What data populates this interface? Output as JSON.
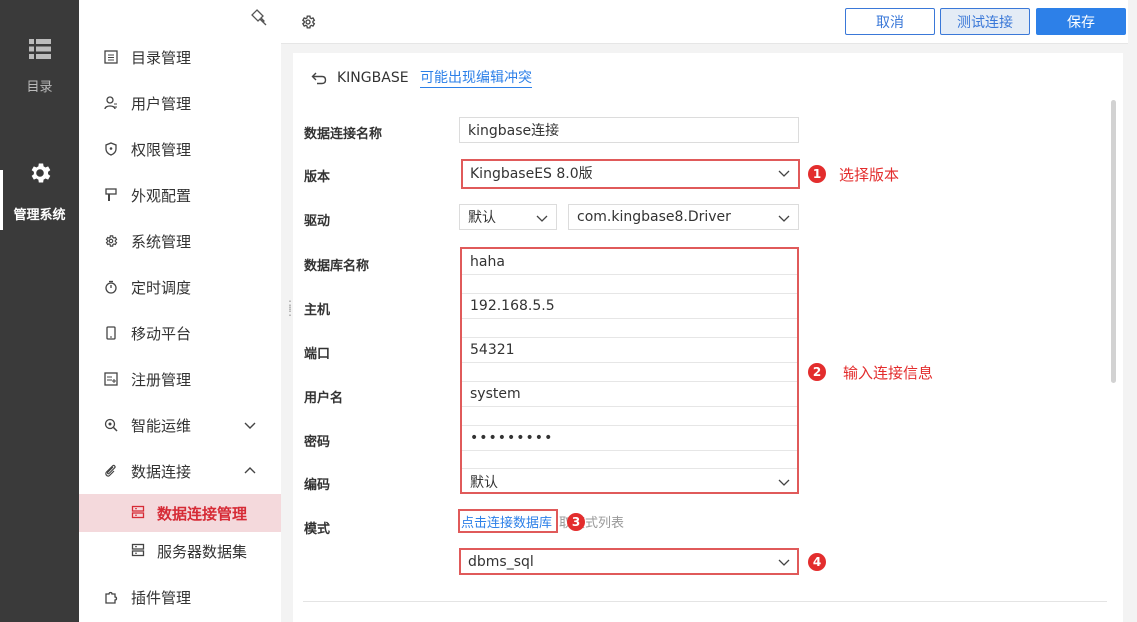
{
  "rail": {
    "catalog_label": "目录",
    "admin_label": "管理系统"
  },
  "sidebar": {
    "items": [
      {
        "label": "目录管理",
        "icon": "catalog-icon"
      },
      {
        "label": "用户管理",
        "icon": "user-icon"
      },
      {
        "label": "权限管理",
        "icon": "shield-icon"
      },
      {
        "label": "外观配置",
        "icon": "brush-icon"
      },
      {
        "label": "系统管理",
        "icon": "gear-icon"
      },
      {
        "label": "定时调度",
        "icon": "timer-icon"
      },
      {
        "label": "移动平台",
        "icon": "phone-icon"
      },
      {
        "label": "注册管理",
        "icon": "register-icon"
      },
      {
        "label": "智能运维",
        "icon": "ops-icon"
      },
      {
        "label": "数据连接",
        "icon": "link-icon"
      }
    ],
    "sub_items": [
      {
        "label": "数据连接管理",
        "icon": "datasource-icon",
        "active": true
      },
      {
        "label": "服务器数据集",
        "icon": "server-dataset-icon",
        "active": false
      }
    ],
    "last_item": {
      "label": "插件管理",
      "icon": "plugin-icon"
    }
  },
  "toolbar": {
    "cancel_label": "取消",
    "test_label": "测试连接",
    "save_label": "保存"
  },
  "header": {
    "db_type": "KINGBASE",
    "conflict_link": "可能出现编辑冲突"
  },
  "form": {
    "name_label": "数据连接名称",
    "name_value": "kingbase连接",
    "version_label": "版本",
    "version_value": "KingbaseES 8.0版",
    "driver_label": "驱动",
    "driver_mode_value": "默认",
    "driver_class_value": "com.kingbase8.Driver",
    "dbname_label": "数据库名称",
    "dbname_value": "haha",
    "host_label": "主机",
    "host_value": "192.168.5.5",
    "port_label": "端口",
    "port_value": "54321",
    "user_label": "用户名",
    "user_value": "system",
    "password_label": "密码",
    "password_value": "•••••••••",
    "encoding_label": "编码",
    "encoding_value": "默认",
    "schema_label": "模式",
    "schema_link": "点击连接数据库",
    "schema_hint": "取模式列表",
    "schema_value": "dbms_sql"
  },
  "annotations": {
    "step1_num": "1",
    "step1_text": "选择版本",
    "step2_num": "2",
    "step2_text": "输入连接信息",
    "step3_num": "3",
    "step4_num": "4",
    "color": "#e32d2d"
  },
  "colors": {
    "accent": "#2d80e8",
    "active_bg": "#f4d9dc",
    "active_text": "#d62b36",
    "rail_bg": "#3a3a3a"
  }
}
